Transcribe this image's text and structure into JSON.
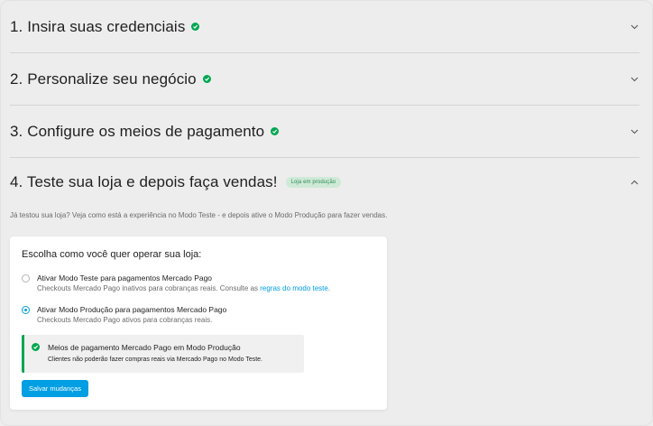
{
  "steps": [
    {
      "title": "1. Insira suas credenciais"
    },
    {
      "title": "2. Personalize seu negócio"
    },
    {
      "title": "3. Configure os meios de pagamento"
    },
    {
      "title": "4. Teste sua loja e depois faça vendas!",
      "badge": "Loja em produção"
    }
  ],
  "intro": "Já testou sua loja? Veja como está a experiência no Modo Teste - e depois ative o Modo Produção para fazer vendas.",
  "card": {
    "title": "Escolha como você quer operar sua loja:",
    "options": [
      {
        "label": "Ativar Modo Teste para pagamentos Mercado Pago",
        "desc": "Checkouts Mercado Pago inativos para cobranças reais. Consulte as ",
        "link": "regras do modo teste",
        "desc_end": ".",
        "selected": false
      },
      {
        "label": "Ativar Modo Produção para pagamentos Mercado Pago",
        "desc": "Checkouts Mercado Pago ativos para cobranças reais.",
        "selected": true
      }
    ],
    "alert": {
      "title": "Meios de pagamento Mercado Pago em Modo Produção",
      "desc": "Clientes não poderão fazer compras reais via Mercado Pago no Modo Teste."
    },
    "save_label": "Salvar mudanças"
  },
  "colors": {
    "accent": "#009ee3",
    "success": "#00a650"
  }
}
